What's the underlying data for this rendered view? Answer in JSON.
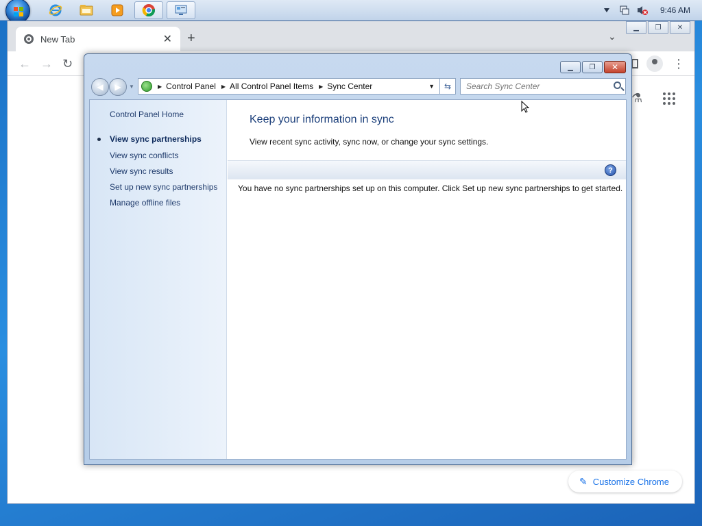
{
  "taskbar": {
    "pinned": [
      {
        "name": "internet-explorer-icon"
      },
      {
        "name": "windows-explorer-icon"
      },
      {
        "name": "media-player-icon"
      },
      {
        "name": "chrome-icon"
      },
      {
        "name": "control-panel-icon"
      }
    ],
    "clock": "9:46 AM"
  },
  "chrome": {
    "tab_title": "New Tab",
    "customize_label": "Customize Chrome",
    "accent": "#1a73e8"
  },
  "sync_center": {
    "breadcrumbs": [
      "Control Panel",
      "All Control Panel Items",
      "Sync Center"
    ],
    "search_placeholder": "Search Sync Center",
    "nav": {
      "home": "Control Panel Home",
      "items": [
        "View sync partnerships",
        "View sync conflicts",
        "View sync results",
        "Set up new sync partnerships",
        "Manage offline files"
      ],
      "current_index": 0
    },
    "heading": "Keep your information in sync",
    "subheading": "View recent sync activity, sync now, or change your sync settings.",
    "empty_message": "You have no sync partnerships set up on this computer. Click Set up new sync partnerships to get started.",
    "help_glyph": "?"
  }
}
